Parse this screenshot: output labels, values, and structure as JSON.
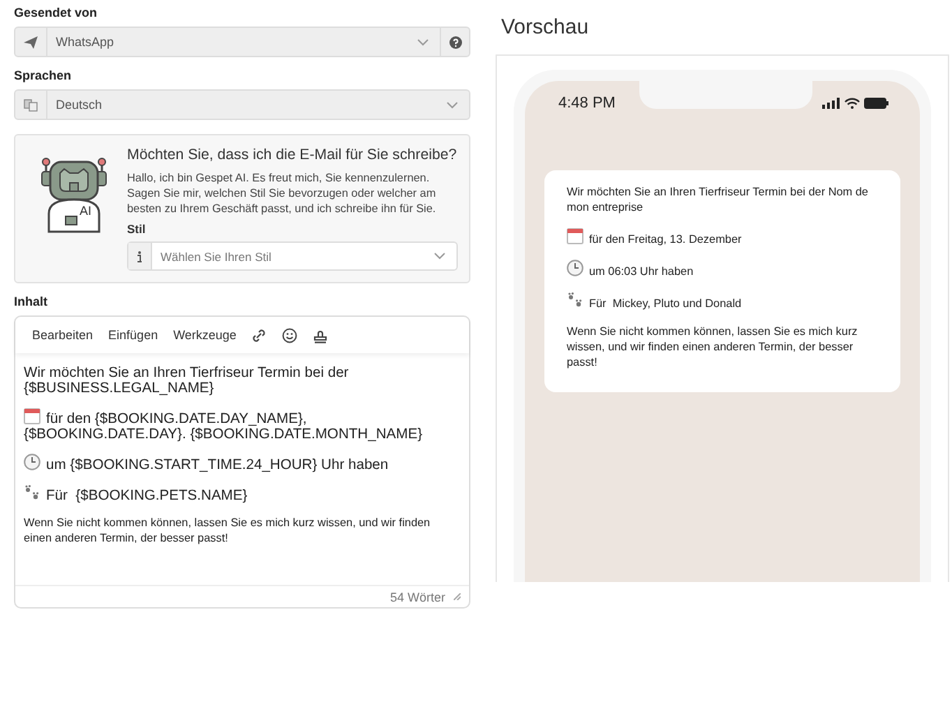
{
  "sender": {
    "label": "Gesendet von",
    "value": "WhatsApp"
  },
  "language": {
    "label": "Sprachen",
    "value": "Deutsch"
  },
  "ai_card": {
    "title": "Möchten Sie, dass ich die E-Mail für Sie schreibe?",
    "text": "Hallo, ich bin Gespet AI. Es freut mich, Sie kennenzulernen. Sagen Sie mir, welchen Stil Sie bevorzugen oder welcher am besten zu Ihrem Geschäft passt, und ich schreibe ihn für Sie.",
    "robot_badge": "AI",
    "style_label": "Stil",
    "style_placeholder": "Wählen Sie Ihren Stil"
  },
  "content": {
    "label": "Inhalt",
    "menu": [
      "Bearbeiten",
      "Einfügen",
      "Werkzeuge"
    ],
    "lines": [
      {
        "kind": "text",
        "text": "Wir möchten Sie an Ihren Tierfriseur Termin bei der {$BUSINESS.LEGAL_NAME}"
      },
      {
        "kind": "calendar",
        "text": "für den {$BOOKING.DATE.DAY_NAME}, {$BOOKING.DATE.DAY}. {$BOOKING.DATE.MONTH_NAME}"
      },
      {
        "kind": "clock",
        "text": "um {$BOOKING.START_TIME.24_HOUR} Uhr haben"
      },
      {
        "kind": "paw",
        "text": "Für  {$BOOKING.PETS.NAME}"
      },
      {
        "kind": "note",
        "text": "Wenn Sie nicht kommen können, lassen Sie es mich kurz wissen, und wir finden einen anderen Termin, der besser passt!"
      }
    ],
    "word_count": "54 Wörter"
  },
  "preview": {
    "title": "Vorschau",
    "time": "4:48 PM",
    "lines": [
      {
        "kind": "text",
        "text": "Wir möchten Sie an Ihren Tierfriseur Termin bei der Nom de mon entreprise"
      },
      {
        "kind": "calendar",
        "text": "für den Freitag, 13. Dezember"
      },
      {
        "kind": "clock",
        "text": "um 06:03 Uhr haben"
      },
      {
        "kind": "paw",
        "text": "Für  Mickey, Pluto und Donald"
      },
      {
        "kind": "text",
        "text": "Wenn Sie nicht kommen können, lassen Sie es mich kurz wissen, und wir finden einen anderen Termin, der besser passt!"
      }
    ]
  }
}
